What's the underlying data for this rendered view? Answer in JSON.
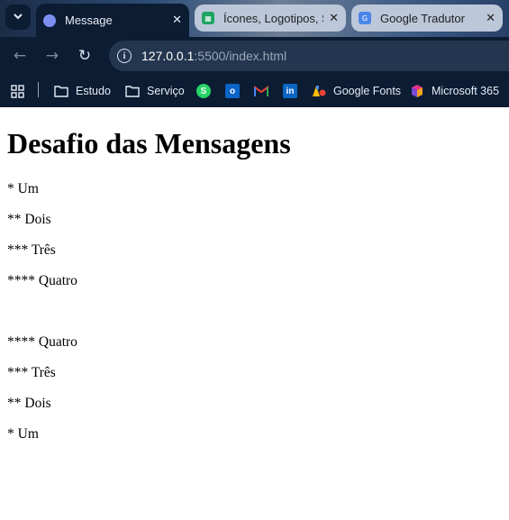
{
  "browser": {
    "tabs": [
      {
        "title": "Message",
        "active": true
      },
      {
        "title": "Ícones, Logotipos, S",
        "active": false
      },
      {
        "title": "Google Tradutor",
        "active": false
      }
    ],
    "address": {
      "host": "127.0.0.1",
      "path": ":5500/index.html"
    },
    "bookmarks": [
      {
        "label": "Estudo",
        "icon": "folder-icon"
      },
      {
        "label": "Serviço",
        "icon": "folder-icon"
      },
      {
        "label": "",
        "icon": "whatsapp-icon"
      },
      {
        "label": "",
        "icon": "outlook-icon"
      },
      {
        "label": "",
        "icon": "gmail-icon"
      },
      {
        "label": "",
        "icon": "linkedin-icon"
      },
      {
        "label": "Google Fonts",
        "icon": "google-fonts-icon"
      },
      {
        "label": "Microsoft 365",
        "icon": "microsoft-365-icon"
      }
    ]
  },
  "page": {
    "heading": "Desafio das Mensagens",
    "lines": [
      "* Um",
      "** Dois",
      "*** Três",
      "**** Quatro",
      "**** Quatro",
      "*** Três",
      "** Dois",
      "* Um"
    ]
  }
}
